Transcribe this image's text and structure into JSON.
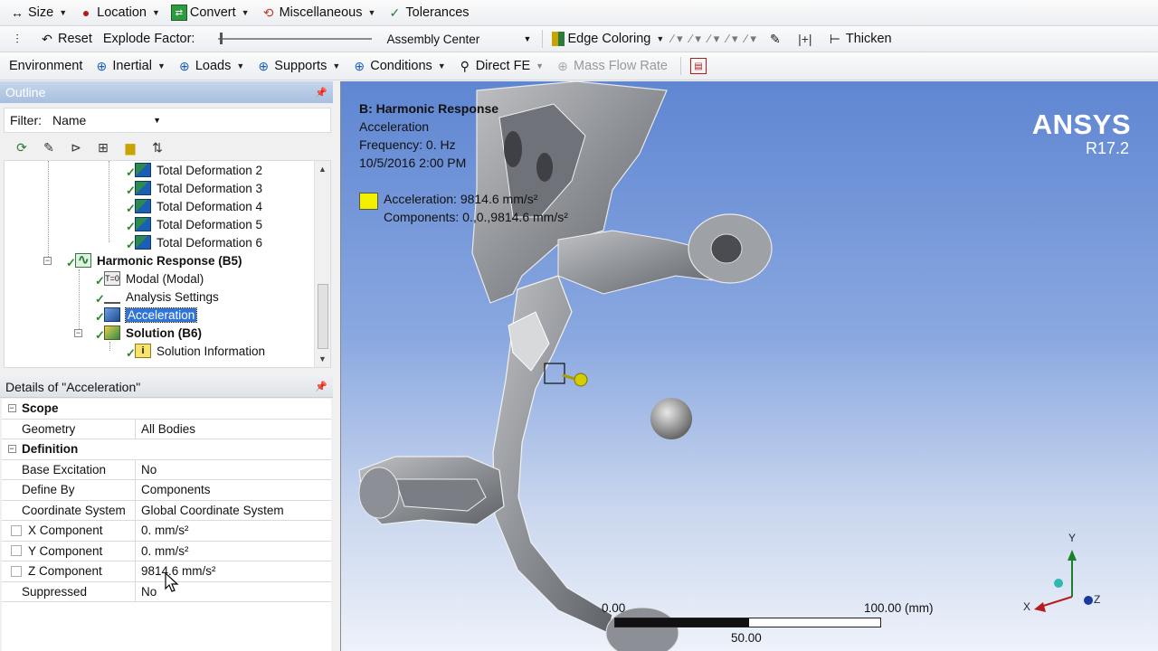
{
  "toolbar1": {
    "items": [
      {
        "label": "Size",
        "icon": "resize-arrows-icon"
      },
      {
        "label": "Location",
        "icon": "location-pin-icon"
      },
      {
        "label": "Convert",
        "icon": "convert-icon"
      },
      {
        "label": "Miscellaneous",
        "icon": "miscellaneous-icon"
      },
      {
        "label": "Tolerances",
        "icon": "tolerances-check-icon"
      }
    ]
  },
  "toolbar2": {
    "reset_label": "Reset",
    "explode_label": "Explode Factor:",
    "explode_value": 0,
    "assembly_value": "Assembly Center",
    "edge_coloring_label": "Edge Coloring",
    "thicken_label": "Thicken"
  },
  "toolbar3": {
    "environment_label": "Environment",
    "items": [
      {
        "label": "Inertial"
      },
      {
        "label": "Loads"
      },
      {
        "label": "Supports"
      },
      {
        "label": "Conditions"
      },
      {
        "label": "Direct FE"
      }
    ],
    "mass_flow_label": "Mass Flow Rate"
  },
  "outline": {
    "title": "Outline",
    "filter_label": "Filter:",
    "filter_value": "Name",
    "nodes": [
      {
        "label": "Total Deformation 2"
      },
      {
        "label": "Total Deformation 3"
      },
      {
        "label": "Total Deformation 4"
      },
      {
        "label": "Total Deformation 5"
      },
      {
        "label": "Total Deformation 6"
      },
      {
        "label": "Harmonic Response (B5)"
      },
      {
        "label": "Modal (Modal)"
      },
      {
        "label": "Analysis Settings"
      },
      {
        "label": "Acceleration"
      },
      {
        "label": "Solution (B6)"
      },
      {
        "label": "Solution Information"
      }
    ],
    "modal_icon_text": "T=0"
  },
  "details": {
    "title": "Details of \"Acceleration\"",
    "groups": {
      "scope": "Scope",
      "definition": "Definition"
    },
    "rows": {
      "geometry": {
        "k": "Geometry",
        "v": "All Bodies"
      },
      "base_excitation": {
        "k": "Base Excitation",
        "v": "No"
      },
      "define_by": {
        "k": "Define By",
        "v": "Components"
      },
      "coord_system": {
        "k": "Coordinate System",
        "v": "Global Coordinate System"
      },
      "x_component": {
        "k": "X Component",
        "v": "0. mm/s²"
      },
      "y_component": {
        "k": "Y Component",
        "v": "0. mm/s²"
      },
      "z_component": {
        "k": "Z Component",
        "v": "9814.6 mm/s²"
      },
      "suppressed": {
        "k": "Suppressed",
        "v": "No"
      }
    }
  },
  "viewport": {
    "legend_title": "B: Harmonic Response",
    "legend_lines": [
      "Acceleration",
      "Frequency: 0. Hz",
      "10/5/2016 2:00 PM"
    ],
    "legend_entry": "Acceleration: 9814.6 mm/s²",
    "legend_components": "Components: 0.,0.,9814.6 mm/s²",
    "legend_color": "#f3ef00",
    "logo": "ANSYS",
    "version": "R17.2",
    "scale": {
      "start": "0.00",
      "mid": "50.00",
      "end": "100.00 (mm)"
    },
    "triad": {
      "x": "X",
      "y": "Y",
      "z": "Z"
    }
  }
}
